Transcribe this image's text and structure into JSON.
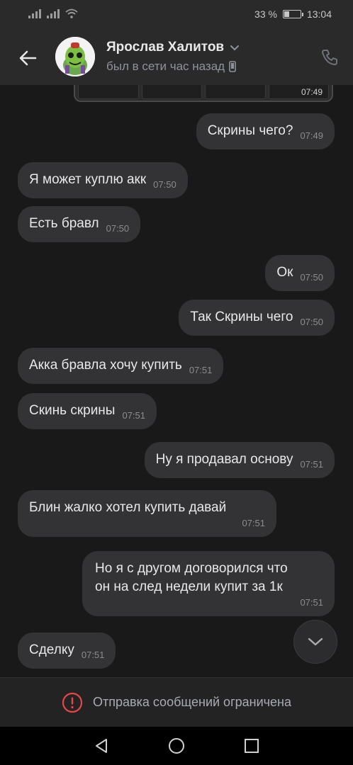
{
  "status_bar": {
    "battery": "33 %",
    "battery_level": 0.33,
    "time": "13:04"
  },
  "header": {
    "name": "Ярослав Халитов",
    "status": "был в сети час назад"
  },
  "screenshot_preview": {
    "time": "07:49"
  },
  "messages": [
    {
      "side": "out",
      "text": "Скрины чего?",
      "time": "07:49"
    },
    {
      "side": "in",
      "text": "Я может куплю акк",
      "time": "07:50"
    },
    {
      "side": "in",
      "text": "Есть бравл",
      "time": "07:50"
    },
    {
      "side": "out",
      "text": "Ок",
      "time": "07:50"
    },
    {
      "side": "out",
      "text": "Так Скрины чего",
      "time": "07:50"
    },
    {
      "side": "in",
      "text": "Акка бравла хочу купить",
      "time": "07:51"
    },
    {
      "side": "in",
      "text": "Скинь скрины",
      "time": "07:51"
    },
    {
      "side": "out",
      "text": "Ну я продавал основу",
      "time": "07:51"
    },
    {
      "side": "in",
      "text": "Блин жалко хотел купить давай",
      "time": "07:51"
    },
    {
      "side": "out",
      "text": "Но я с другом договорился что он на след недели купит за 1к",
      "line1": "Но я с другом договорился что",
      "line2": "он на след недели купит за 1к",
      "time": "07:51"
    },
    {
      "side": "in",
      "text": "Сделку",
      "time": "07:51"
    }
  ],
  "footer": {
    "restriction_text": "Отправка сообщений ограничена"
  },
  "icons": {
    "back": "arrow-left-icon",
    "phone": "phone-icon",
    "scroll": "chevron-down-icon",
    "warning": "alert-circle-icon",
    "accent_warning": "#e64646"
  }
}
